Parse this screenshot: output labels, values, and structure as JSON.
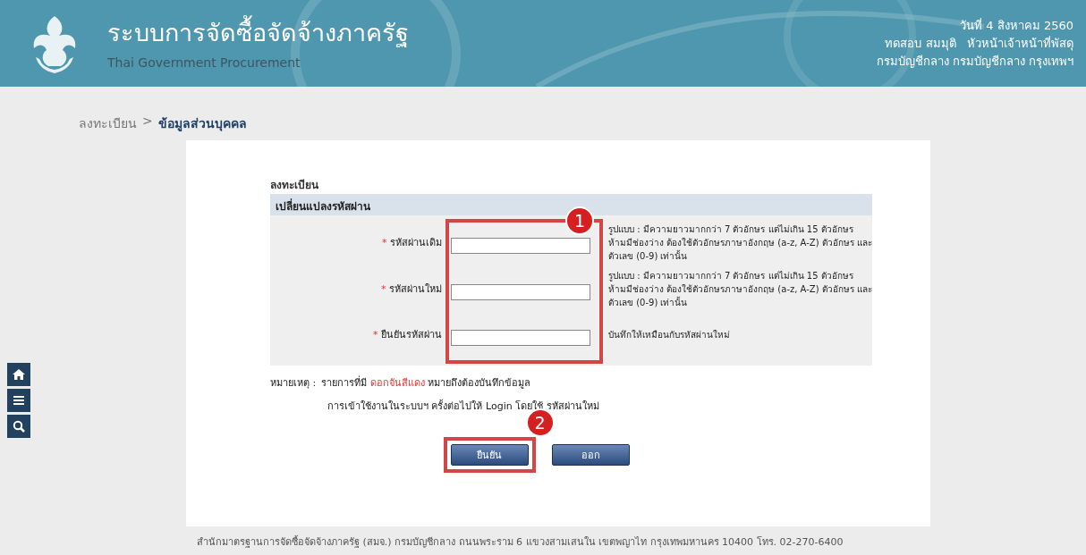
{
  "header": {
    "title": "ระบบการจัดซื้อจัดจ้างภาครัฐ",
    "subtitle": "Thai Government Procurement",
    "date": "วันที่ 4 สิงหาคม 2560",
    "user": "ทดสอบ สมมุติ   หัวหน้าเจ้าหน้าที่พัสดุ",
    "organization": "กรมบัญชีกลาง กรมบัญชีกลาง กรุงเทพฯ"
  },
  "breadcrumb": [
    {
      "label": "ลงทะเบียน",
      "current": false
    },
    {
      "label": ">",
      "current": false
    },
    {
      "label": "ข้อมูลส่วนบุคคล",
      "current": true
    }
  ],
  "side_tools": [
    {
      "kind": "home"
    },
    {
      "kind": "menu"
    },
    {
      "kind": "search"
    }
  ],
  "form": {
    "title": "ลงทะเบียน",
    "section": "เปลี่ยนแปลงรหัสผ่าน",
    "fields": [
      {
        "label": "รหัสผ่านเดิม",
        "required_mark": "*",
        "hint": "รูปแบบ : มีความยาวมากกว่า 7 ตัวอักษร แต่ไม่เกิน 15 ตัวอักษร ห้ามมีช่องว่าง ต้องใช้ตัวอักษรภาษาอังกฤษ (a-z, A-Z) ตัวอักษร และตัวเลข (0-9) เท่านั้น"
      },
      {
        "label": "รหัสผ่านใหม่",
        "required_mark": "*",
        "hint": "รูปแบบ : มีความยาวมากกว่า 7 ตัวอักษร แต่ไม่เกิน 15 ตัวอักษร ห้ามมีช่องว่าง ต้องใช้ตัวอักษรภาษาอังกฤษ (a-z, A-Z) ตัวอักษร และตัวเลข (0-9) เท่านั้น"
      },
      {
        "label": "ยืนยันรหัสผ่าน",
        "required_mark": "*",
        "hint": "บันทึกให้เหมือนกับรหัสผ่านใหม่"
      }
    ],
    "fields_badge": "1",
    "note": {
      "label": "หมายเหตุ :",
      "parts": [
        {
          "text": "รายการที่มี",
          "highlight": false
        },
        {
          "text": "ดอกจันสีแดง",
          "highlight": true
        },
        {
          "text": "หมายถึงต้องบันทึกข้อมูล",
          "highlight": false
        }
      ],
      "line2": "การเข้าใช้งานในระบบฯ ครั้งต่อไปให้ Login โดยใช้ รหัสผ่านใหม่"
    },
    "buttons": [
      {
        "label": "ยืนยัน",
        "marked": true,
        "badge": "2"
      },
      {
        "label": "ออก",
        "marked": false
      }
    ]
  },
  "footer": "สำนักมาตรฐานการจัดซื้อจัดจ้างภาครัฐ (สมจ.) กรมบัญชีกลาง ถนนพระราม 6 แขวงสามเสนใน เขตพญาไท กรุงเทพมหานคร 10400 โทร. 02-270-6400"
}
